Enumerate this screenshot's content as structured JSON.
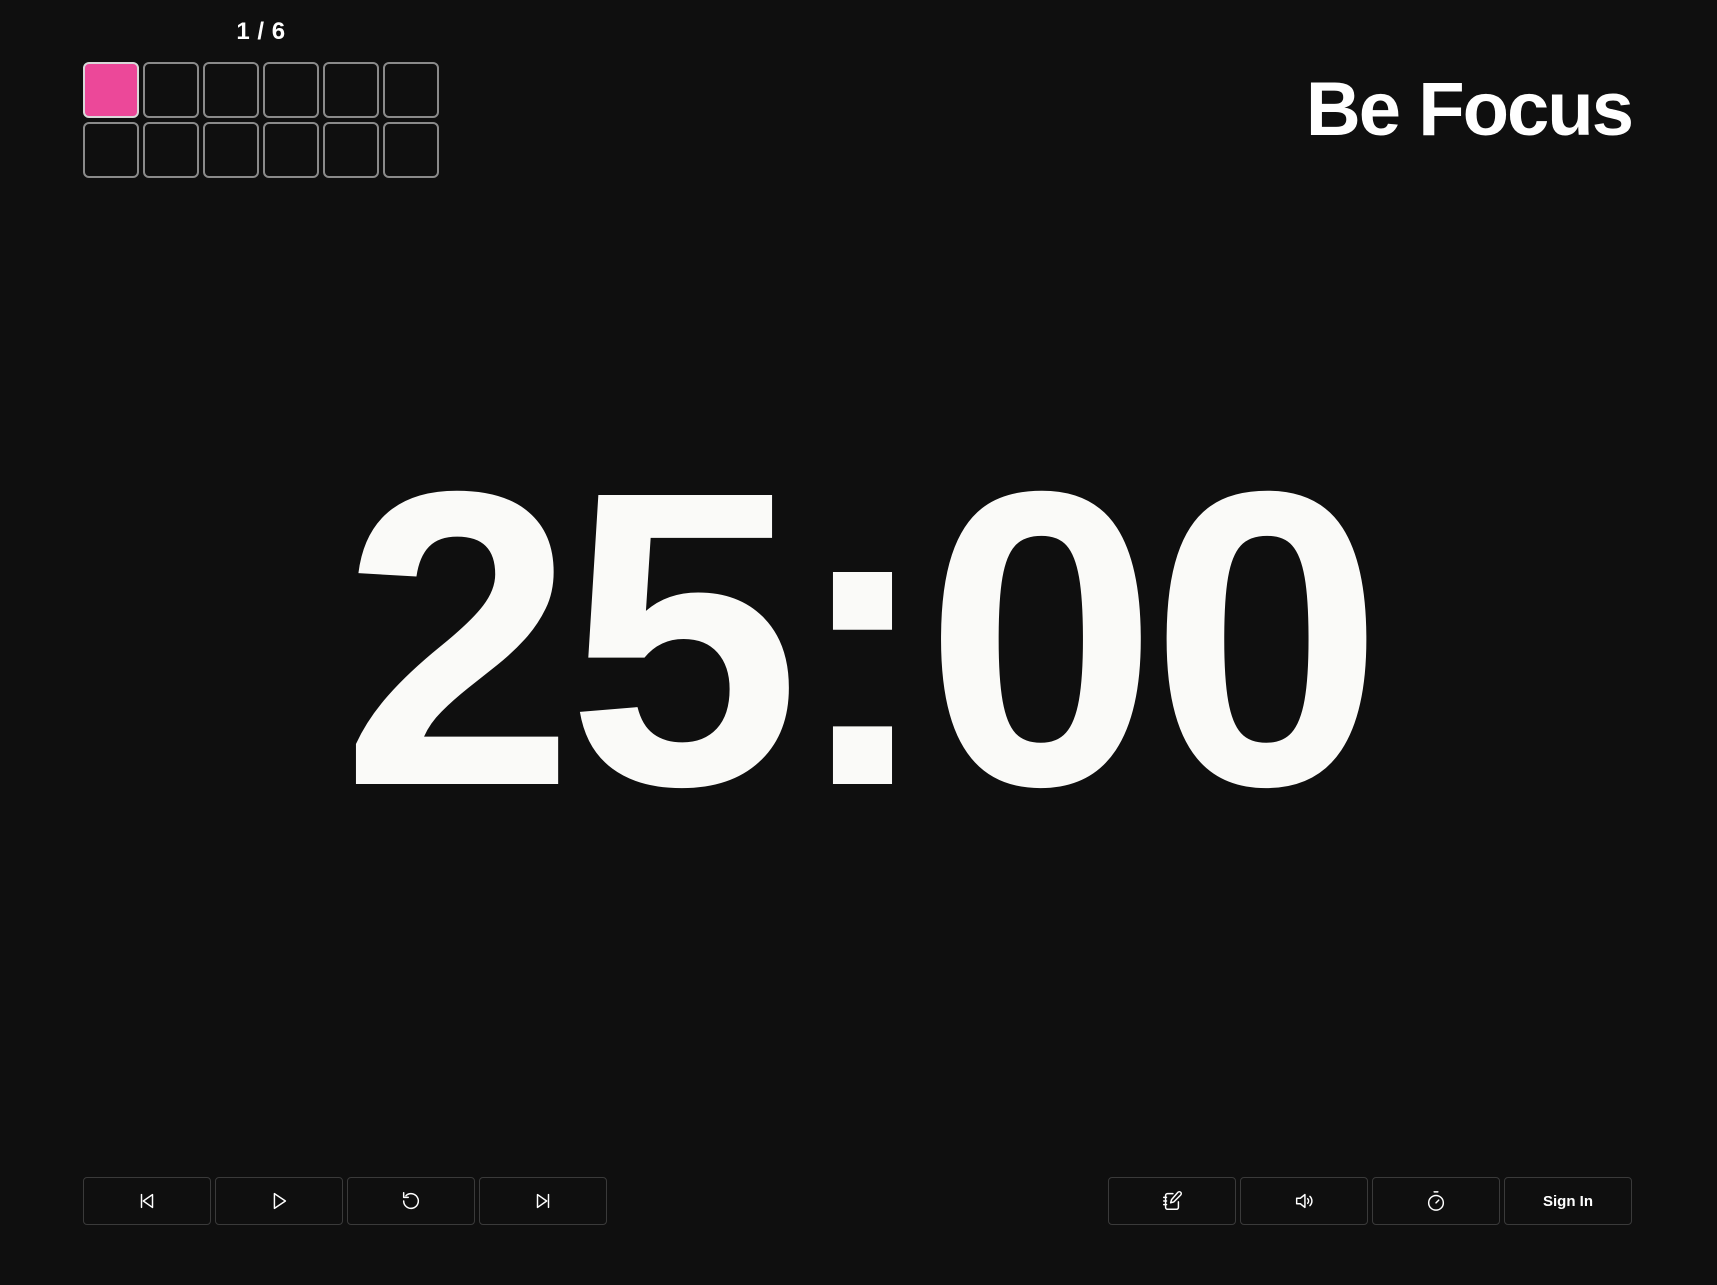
{
  "app": {
    "brand": "Be Focus",
    "accent_color": "#ec4899",
    "background_color": "#0f0f0f"
  },
  "session": {
    "counter": "1 / 6",
    "total_cells": 12,
    "completed_cells": 1
  },
  "timer": {
    "display": "25:00"
  },
  "controls": {
    "left": [
      {
        "name": "previous-button",
        "icon": "skip-previous-icon"
      },
      {
        "name": "play-button",
        "icon": "play-icon"
      },
      {
        "name": "reset-button",
        "icon": "reset-icon"
      },
      {
        "name": "next-button",
        "icon": "skip-next-icon"
      }
    ],
    "right": [
      {
        "name": "notes-button",
        "icon": "notebook-pen-icon"
      },
      {
        "name": "sound-button",
        "icon": "volume-icon"
      },
      {
        "name": "timer-settings-button",
        "icon": "stopwatch-icon"
      }
    ],
    "sign_in_label": "Sign In"
  }
}
